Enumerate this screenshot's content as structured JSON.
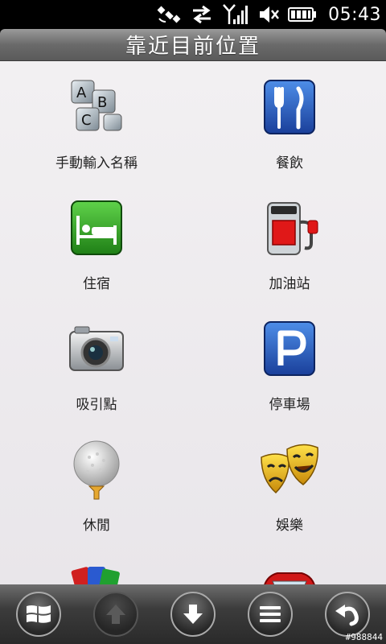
{
  "status": {
    "time": "05:43"
  },
  "header": {
    "title": "靠近目前位置"
  },
  "categories": [
    {
      "label": "手動輸入名稱",
      "icon": "abc-blocks-icon"
    },
    {
      "label": "餐飲",
      "icon": "fork-knife-icon"
    },
    {
      "label": "住宿",
      "icon": "bed-icon"
    },
    {
      "label": "加油站",
      "icon": "gas-pump-icon"
    },
    {
      "label": "吸引點",
      "icon": "camera-icon"
    },
    {
      "label": "停車場",
      "icon": "parking-icon"
    },
    {
      "label": "休閒",
      "icon": "golf-ball-icon"
    },
    {
      "label": "娛樂",
      "icon": "theater-masks-icon"
    },
    {
      "label": "",
      "icon": "shopping-icon"
    },
    {
      "label": "",
      "icon": "car-icon"
    }
  ],
  "toolbar": {
    "items": [
      "windows-icon",
      "arrow-up-icon",
      "arrow-down-icon",
      "menu-icon",
      "back-icon"
    ]
  },
  "watermark": "#988844",
  "colors": {
    "title_bar": "#6a6a6a",
    "content_bg": "#eeecef",
    "toolbar": "#3c3c3c"
  }
}
